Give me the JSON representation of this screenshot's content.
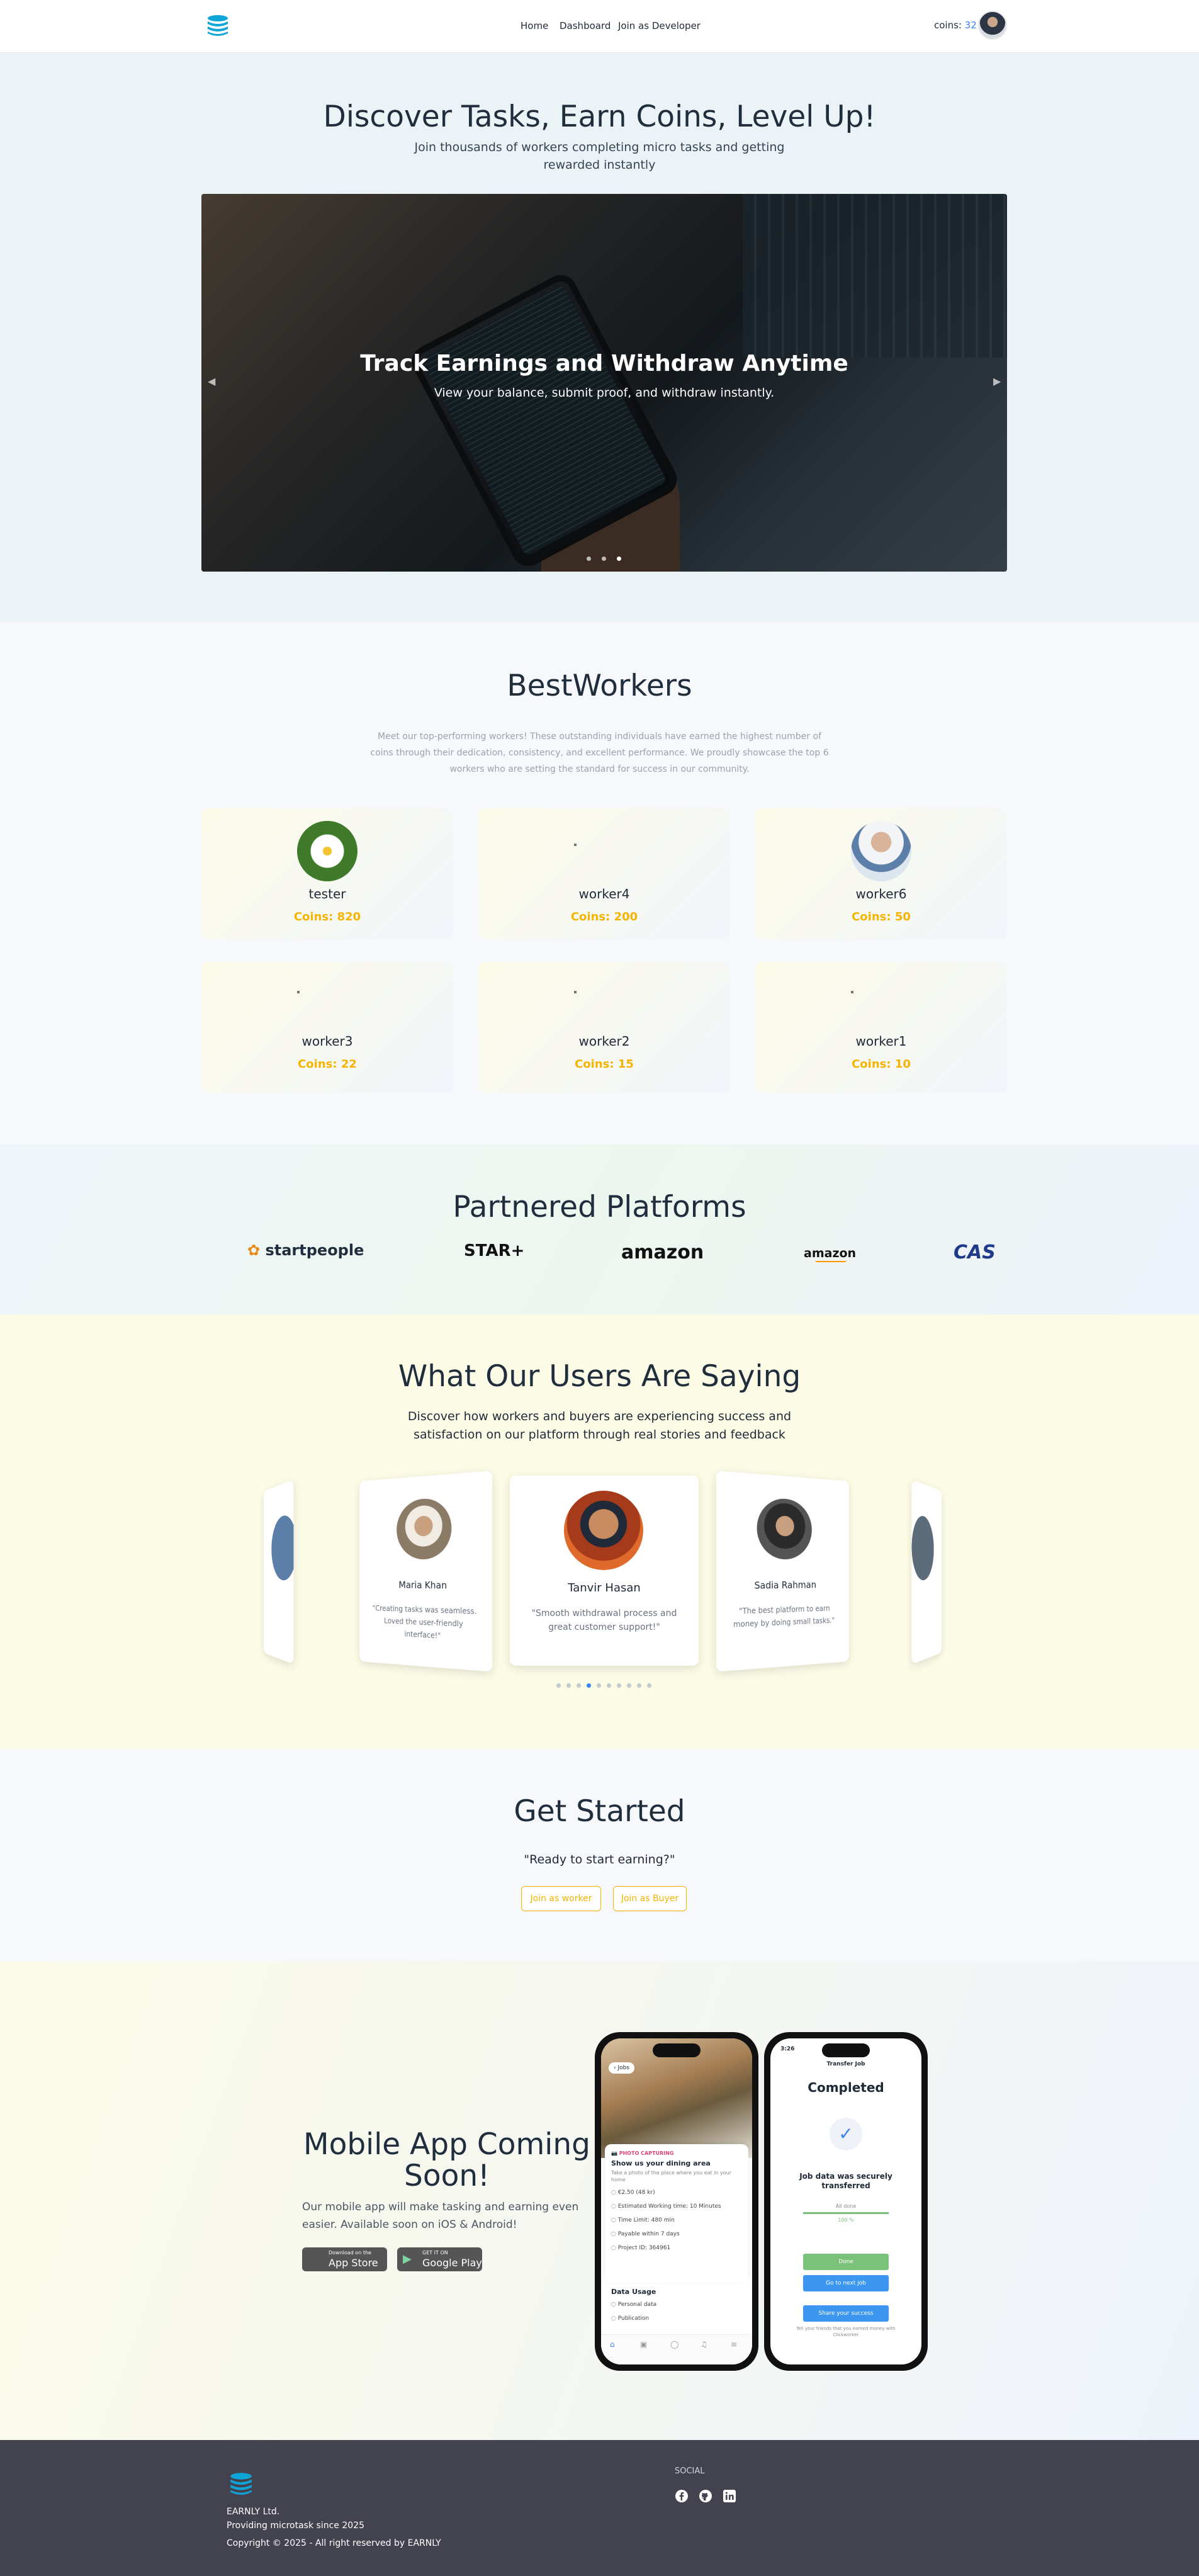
{
  "nav": {
    "links": [
      "Home",
      "Dashboard",
      "Join as Developer"
    ],
    "coins_label": "coins:",
    "coins_value": "32"
  },
  "hero": {
    "title": "Discover Tasks, Earn Coins, Level Up!",
    "subtitle": "Join thousands of workers completing micro tasks and getting rewarded instantly",
    "slide_title": "Track Earnings and Withdraw Anytime",
    "slide_subtitle": "View your balance, submit proof, and withdraw instantly.",
    "slide_count": 3,
    "active_slide": 3
  },
  "best_workers": {
    "title": "BestWorkers",
    "description": "Meet our top-performing workers! These outstanding individuals have earned the highest number of coins through their dedication, consistency, and excellent performance. We proudly showcase the top 6 workers who are setting the standard for success in our community.",
    "workers": [
      {
        "name": "tester",
        "coins": "Coins: 820",
        "avatar": "flower"
      },
      {
        "name": "worker4",
        "coins": "Coins: 200",
        "avatar": "broken"
      },
      {
        "name": "worker6",
        "coins": "Coins: 50",
        "avatar": "man"
      },
      {
        "name": "worker3",
        "coins": "Coins: 22",
        "avatar": "broken"
      },
      {
        "name": "worker2",
        "coins": "Coins: 15",
        "avatar": "broken"
      },
      {
        "name": "worker1",
        "coins": "Coins: 10",
        "avatar": "broken"
      }
    ]
  },
  "partners": {
    "title": "Partnered Platforms",
    "logos": [
      "startpeople",
      "STAR+",
      "amazon",
      "amazon",
      "CAS"
    ],
    "logo_colors": [
      "#1f2d3d",
      "#111111",
      "#111111",
      "#111111",
      "#1e3a8a"
    ]
  },
  "testimonials": {
    "title": "What Our Users Are Saying",
    "subtitle": "Discover how workers and buyers are experiencing success and satisfaction on our platform through real stories and feedback",
    "cards": [
      {
        "name": "Maria Khan",
        "quote": "\"Creating tasks was seamless. Loved the user-friendly interface!\""
      },
      {
        "name": "Tanvir Hasan",
        "quote": "\"Smooth withdrawal process and great customer support!\""
      },
      {
        "name": "Sadia Rahman",
        "quote": "\"The best platform to earn money by doing small tasks.\""
      }
    ],
    "dot_count": 10,
    "active_dot": 3
  },
  "get_started": {
    "title": "Get Started",
    "subtitle": "\"Ready to start earning?\"",
    "worker_button": "Join as worker",
    "buyer_button": "Join as Buyer"
  },
  "mobile": {
    "title": "Mobile App Coming Soon!",
    "description": "Our mobile app will make tasking and earning even easier. Available soon on iOS & Android!",
    "app_store_small": "Download on the",
    "app_store_big": "App Store",
    "google_small": "GET IT ON",
    "google_big": "Google Play",
    "phone1": {
      "back": "Jobs",
      "tag": "PHOTO CAPTURING",
      "heading": "Show us your dining area",
      "hint": "Take a photo of the place where you eat in your home",
      "rows": [
        "€2.50 (48 kr)",
        "Estimated Working time: 10 Minutes",
        "Time Limit: 480 min",
        "Payable within 7 days",
        "Project ID: 364961"
      ],
      "usage_title": "Data Usage",
      "usage_rows": [
        "Personal data",
        "Publication"
      ]
    },
    "phone2": {
      "time": "3:26",
      "header": "Transfer Job",
      "status": "Completed",
      "message": "Job data was securely transferred",
      "all_done": "All done",
      "percent": "100 %",
      "done_button": "Done",
      "next_button": "Go to next job",
      "share_button": "Share your success",
      "footer": "Tell your friends that you earned money with Clickworker"
    }
  },
  "footer": {
    "company": "EARNLY Ltd.",
    "since": "Providing microtask since 2025",
    "copyright": "Copyright © 2025 - All right reserved by EARNLY",
    "social_title": "SOCIAL"
  },
  "colors": {
    "accent": "#f5b400",
    "link_blue": "#3b82f6",
    "footer_bg": "#43424f",
    "logo_blue": "#0ea5d8"
  }
}
